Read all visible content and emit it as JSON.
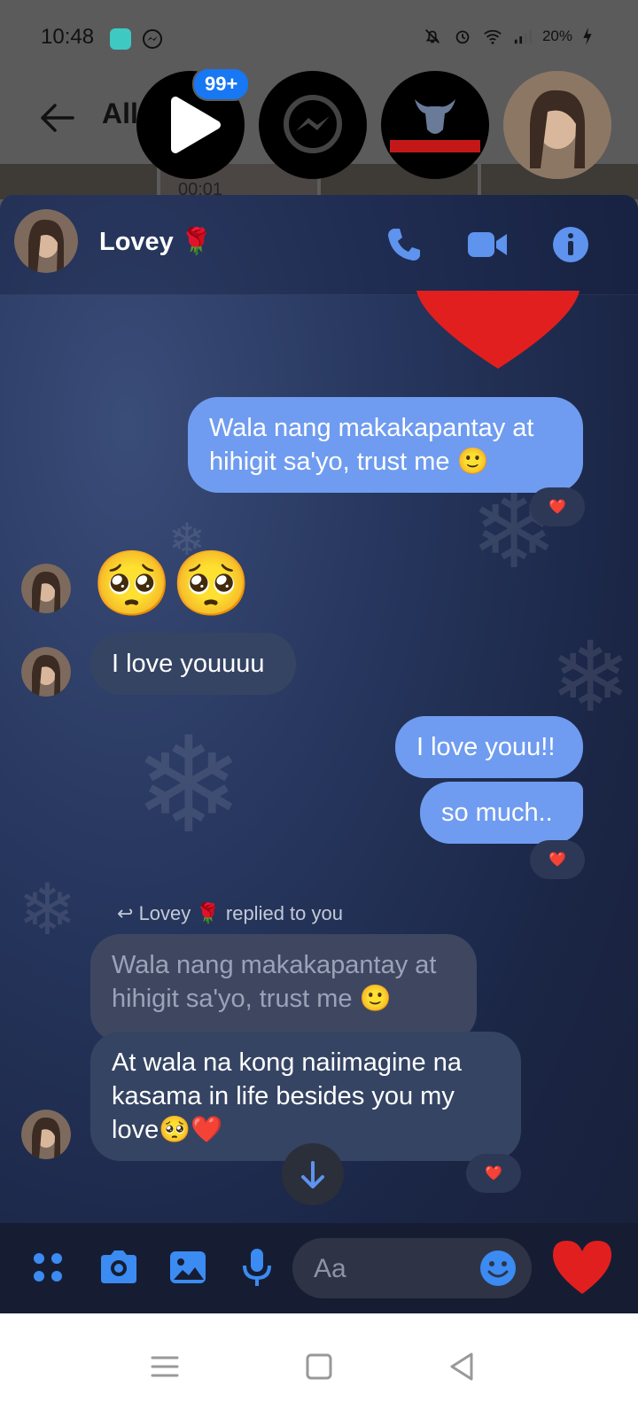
{
  "status_bar": {
    "time": "10:48",
    "battery": "20%"
  },
  "background_app": {
    "title": "All",
    "thumbnail_duration": "00:01",
    "notification_badge": "99+"
  },
  "chat_heads": [
    "play-app",
    "messenger",
    "running-bulls",
    "contact"
  ],
  "conversation": {
    "contact_name": "Lovey 🌹",
    "messages": [
      {
        "dir": "out",
        "text": "Wala nang makakapantay at hihigit sa'yo, trust me 🙂",
        "reaction": "❤️"
      },
      {
        "dir": "in",
        "text": "🥺🥺"
      },
      {
        "dir": "in",
        "text": "I love youuuu"
      },
      {
        "dir": "out",
        "text": "I love youu!!"
      },
      {
        "dir": "out",
        "text": "so much..",
        "reaction": "❤️"
      },
      {
        "dir": "in",
        "reply_label": "Lovey 🌹 replied to you",
        "quoted": "Wala nang makakapantay at hihigit sa'yo, trust me 🙂",
        "text": "At wala na kong naiimagine na kasama in life besides you my love🥺❤️",
        "reaction": "❤️"
      }
    ]
  },
  "composer": {
    "placeholder": "Aa"
  },
  "colors": {
    "outgoing_bubble": "#6f9cf0",
    "incoming_bubble": "#354463",
    "accent": "#1877f2"
  }
}
